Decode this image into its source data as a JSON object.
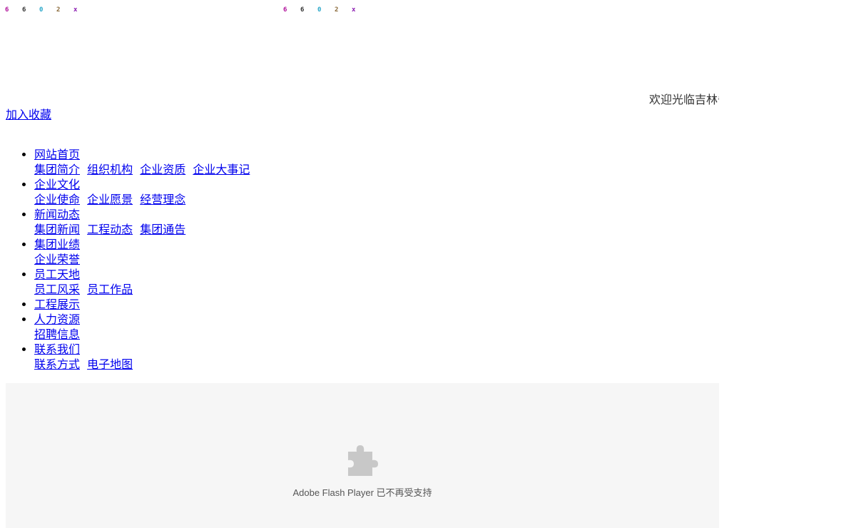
{
  "captcha_left": {
    "chars": [
      "6",
      "6",
      "0",
      "2",
      "x"
    ],
    "colors": [
      "#b0109a",
      "#333333",
      "#2aa7c9",
      "#8a6a3a",
      "#8a1ab0"
    ]
  },
  "captcha_right": {
    "chars": [
      "6",
      "6",
      "0",
      "2",
      "x"
    ],
    "colors": [
      "#b0109a",
      "#333333",
      "#2aa7c9",
      "#8a6a3a",
      "#8a1ab0"
    ]
  },
  "header": {
    "welcome_text": "欢迎光临吉林省",
    "favorite_label": "加入收藏"
  },
  "nav": {
    "items": [
      {
        "label": "网站首页",
        "sub": [
          "集团简介",
          "组织机构",
          "企业资质",
          "企业大事记"
        ]
      },
      {
        "label": "企业文化",
        "sub": [
          "企业使命",
          "企业愿景",
          "经营理念"
        ]
      },
      {
        "label": "新闻动态",
        "sub": [
          "集团新闻",
          "工程动态",
          "集团通告"
        ]
      },
      {
        "label": "集团业绩",
        "sub": [
          "企业荣誉"
        ]
      },
      {
        "label": "员工天地",
        "sub": [
          "员工风采",
          "员工作品"
        ]
      },
      {
        "label": "工程展示",
        "sub": []
      },
      {
        "label": "人力资源",
        "sub": [
          "招聘信息"
        ]
      },
      {
        "label": "联系我们",
        "sub": [
          "联系方式",
          "电子地图"
        ]
      }
    ]
  },
  "flash": {
    "icon": "puzzle-plugin-icon",
    "message": "Adobe Flash Player 已不再受支持",
    "background": "#f6f6f6",
    "icon_color": "#c8c8c8"
  },
  "colors": {
    "link": "#0000ee",
    "text": "#333333"
  }
}
